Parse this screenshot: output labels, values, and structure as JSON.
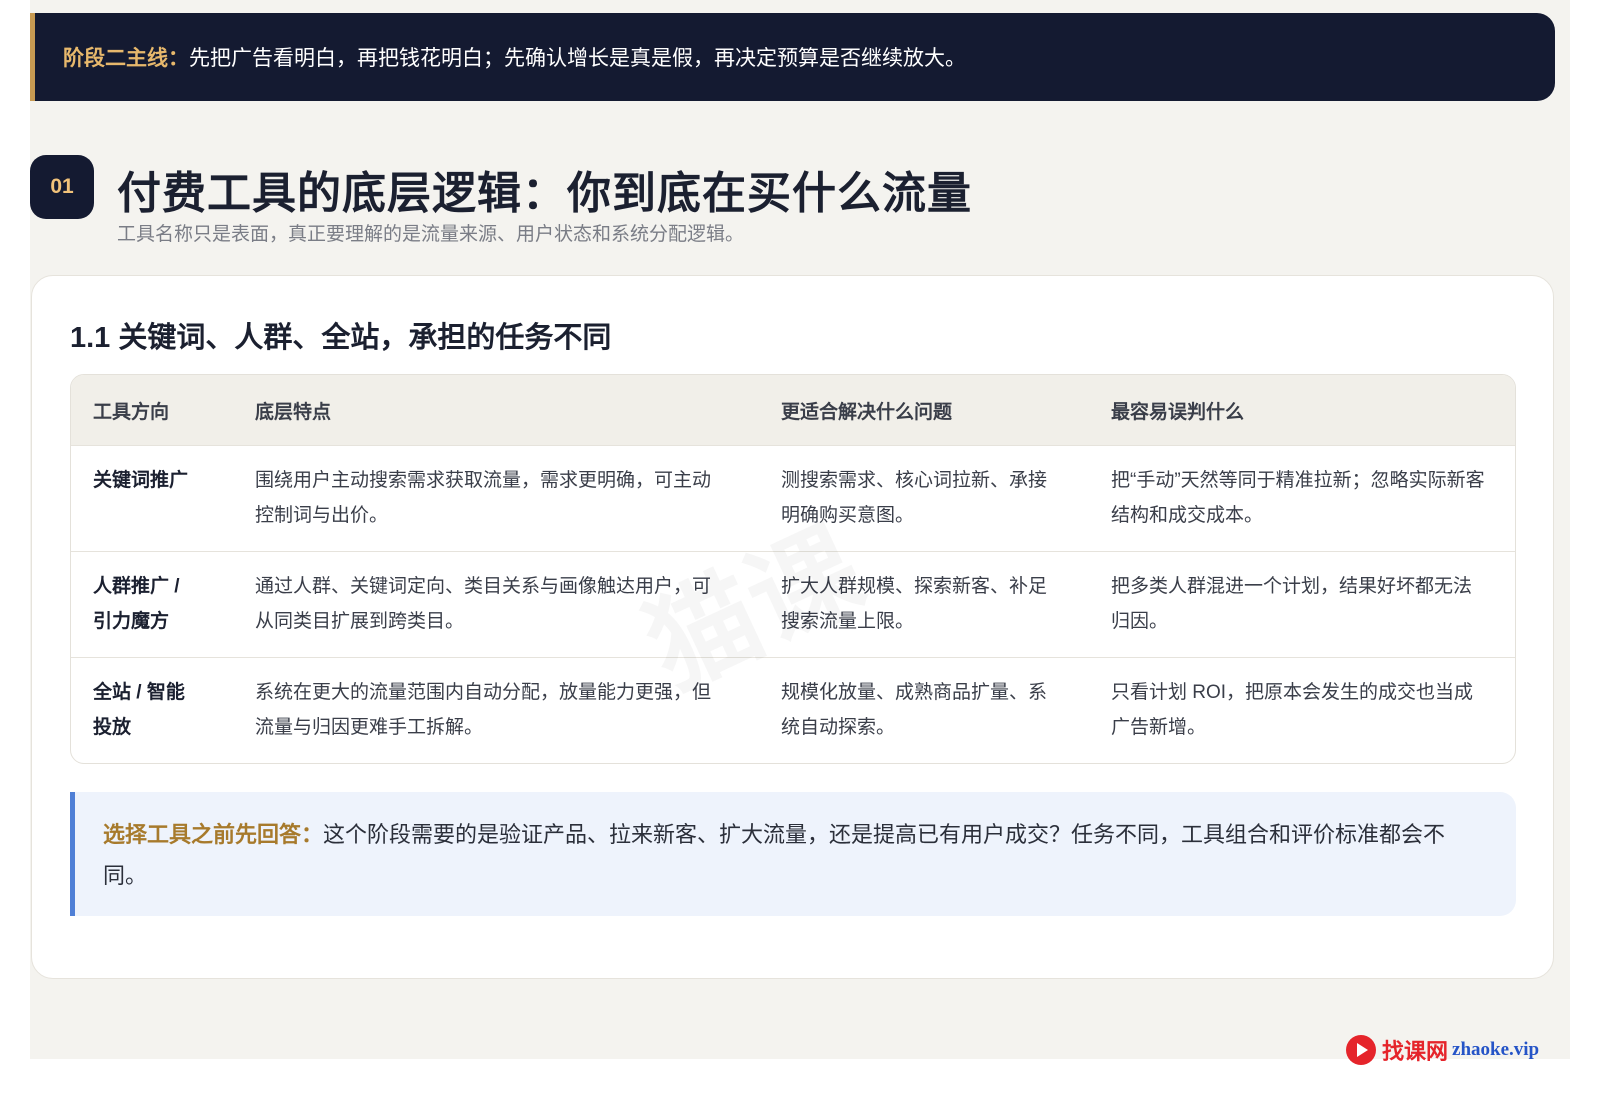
{
  "banner": {
    "lead": "阶段二主线：",
    "text": "先把广告看明白，再把钱花明白；先确认增长是真是假，再决定预算是否继续放大。"
  },
  "section": {
    "number": "01",
    "title": "付费工具的底层逻辑：你到底在买什么流量",
    "subtitle": "工具名称只是表面，真正要理解的是流量来源、用户状态和系统分配逻辑。"
  },
  "card": {
    "title": "1.1 关键词、人群、全站，承担的任务不同",
    "table": {
      "headers": [
        "工具方向",
        "底层特点",
        "更适合解决什么问题",
        "最容易误判什么"
      ],
      "rows": [
        [
          "关键词推广",
          "围绕用户主动搜索需求获取流量，需求更明确，可主动控制词与出价。",
          "测搜索需求、核心词拉新、承接明确购买意图。",
          "把“手动”天然等同于精准拉新；忽略实际新客结构和成交成本。"
        ],
        [
          "人群推广 / 引力魔方",
          "通过人群、关键词定向、类目关系与画像触达用户，可从同类目扩展到跨类目。",
          "扩大人群规模、探索新客、补足搜索流量上限。",
          "把多类人群混进一个计划，结果好坏都无法归因。"
        ],
        [
          "全站 / 智能投放",
          "系统在更大的流量范围内自动分配，放量能力更强，但流量与归因更难手工拆解。",
          "规模化放量、成熟商品扩量、系统自动探索。",
          "只看计划 ROI，把原本会发生的成交也当成广告新增。"
        ]
      ]
    },
    "note": {
      "lead": "选择工具之前先回答：",
      "text": "这个阶段需要的是验证产品、拉来新客、扩大流量，还是提高已有用户成交？任务不同，工具组合和评价标准都会不同。"
    }
  },
  "watermark": "猫课",
  "brand": {
    "cn": "找课网",
    "en": "zhaoke.vip"
  }
}
